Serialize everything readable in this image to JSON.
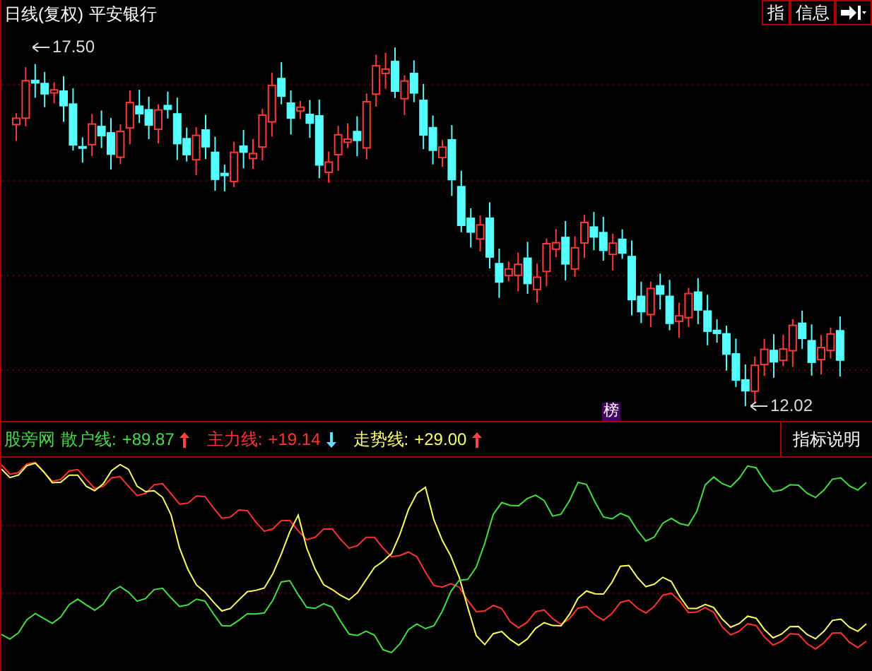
{
  "chart_header": {
    "period": "日线(复权)",
    "stock_name": "平安银行"
  },
  "toolbar": [
    {
      "label": "指"
    },
    {
      "label": "信息"
    }
  ],
  "price_markers": {
    "high": "17.50",
    "low": "12.02"
  },
  "badge": "榜",
  "indicator": {
    "name": "股旁网",
    "lines": [
      {
        "label": "散户线:",
        "value": "+89.87",
        "color": "#44dd44",
        "rising": true
      },
      {
        "label": "主力线:",
        "value": "+19.14",
        "color": "#ff3333",
        "rising": false
      },
      {
        "label": "走势线:",
        "value": "+29.00",
        "color": "#ffff66",
        "rising": true
      }
    ]
  },
  "explain_button": "指标说明"
}
